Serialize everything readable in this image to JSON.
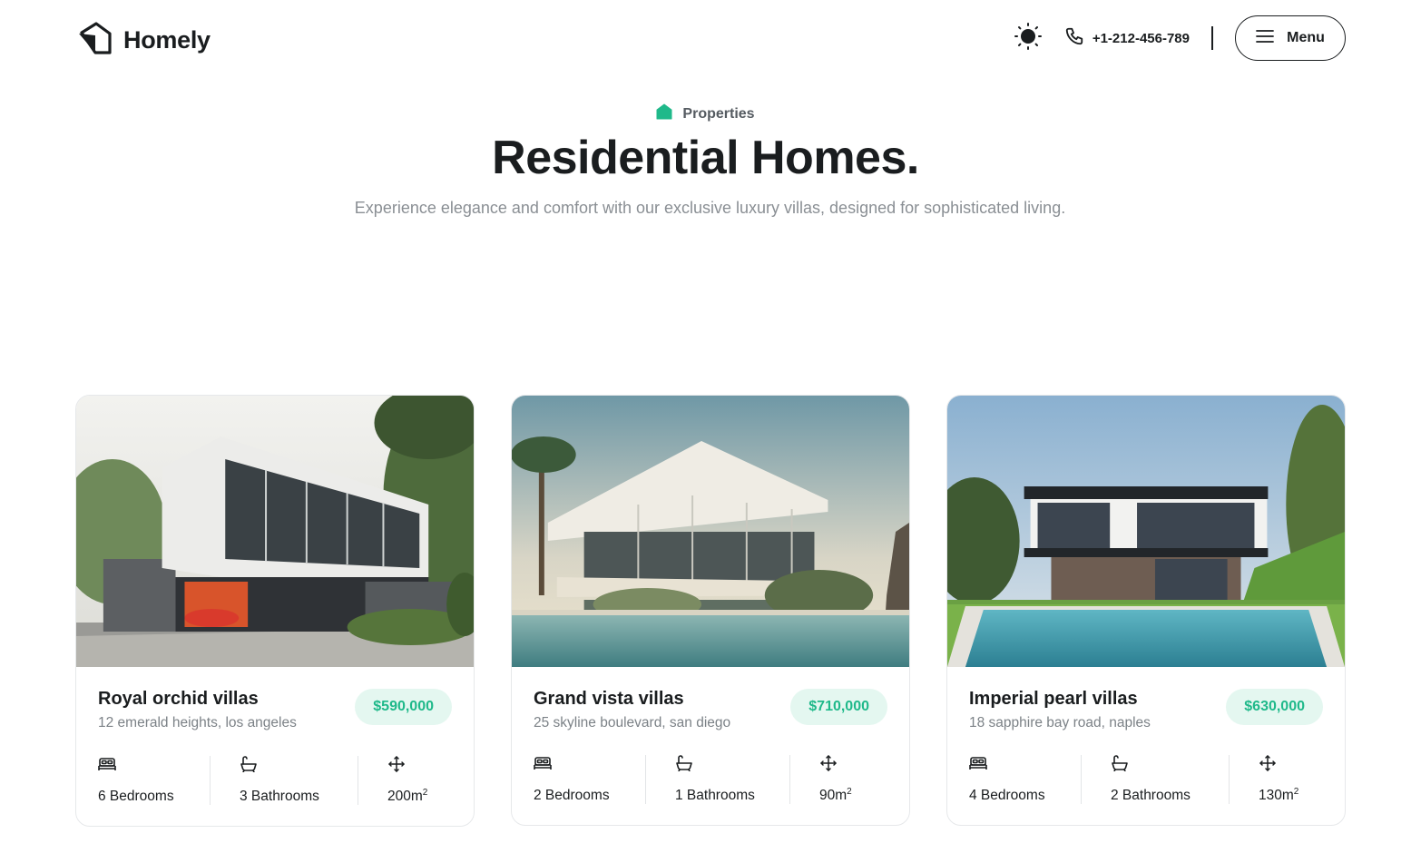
{
  "header": {
    "logo_text": "Homely",
    "phone": "+1-212-456-789",
    "menu_label": "Menu"
  },
  "hero": {
    "tag": "Properties",
    "title": "Residential Homes.",
    "subtitle": "Experience elegance and comfort with our exclusive luxury villas, designed for sophisticated living."
  },
  "cards": [
    {
      "name": "Royal orchid villas",
      "address": "12 emerald heights, los angeles",
      "price": "$590,000",
      "bedrooms": "6 Bedrooms",
      "bathrooms": "3 Bathrooms",
      "area": "200m",
      "area_sup": "2"
    },
    {
      "name": "Grand vista villas",
      "address": "25 skyline boulevard, san diego",
      "price": "$710,000",
      "bedrooms": "2 Bedrooms",
      "bathrooms": "1 Bathrooms",
      "area": "90m",
      "area_sup": "2"
    },
    {
      "name": "Imperial pearl villas",
      "address": "18 sapphire bay road, naples",
      "price": "$630,000",
      "bedrooms": "4 Bedrooms",
      "bathrooms": "2 Bathrooms",
      "area": "130m",
      "area_sup": "2"
    }
  ],
  "icons": {
    "logo": "house-logo-icon",
    "theme": "sun-icon",
    "phone": "phone-icon",
    "menu": "hamburger-icon",
    "tag": "home-icon",
    "bed": "bed-icon",
    "bath": "bathtub-icon",
    "area": "move-arrows-icon"
  },
  "colors": {
    "accent": "#1fb98a",
    "accent_bg": "#e4f7f0",
    "text": "#1a1d1f",
    "muted": "#8a8f94"
  }
}
